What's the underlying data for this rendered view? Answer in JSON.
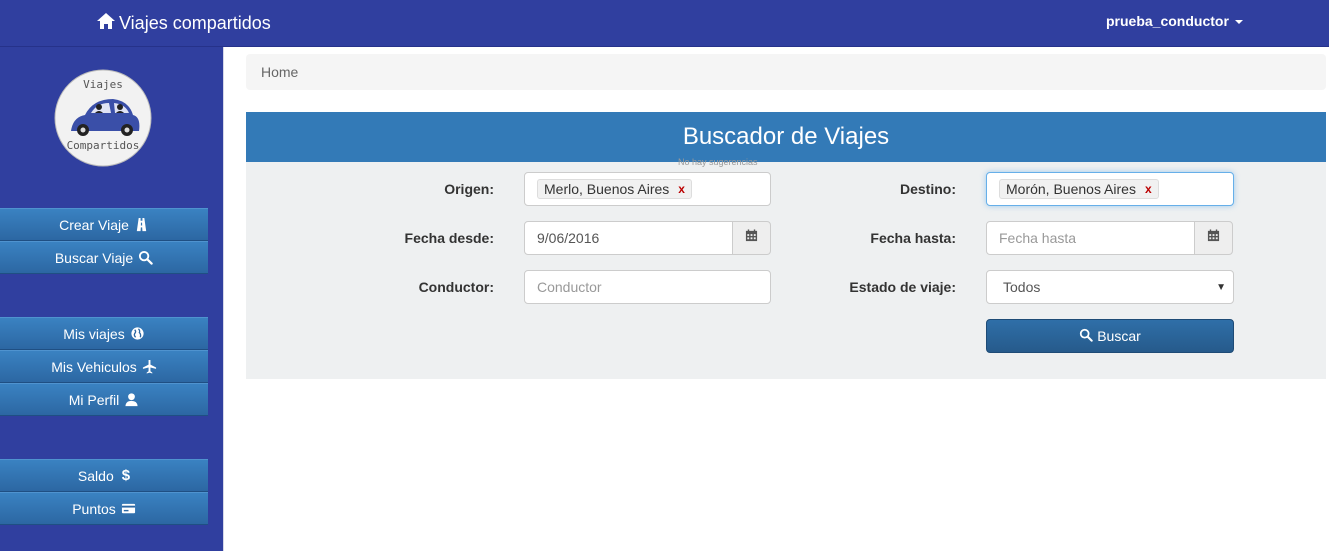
{
  "navbar": {
    "brand": "Viajes compartidos",
    "brand_icon": "home-icon",
    "user": "prueba_conductor"
  },
  "logo": {
    "top_text": "Viajes",
    "bottom_text": "Compartidos"
  },
  "sidebar": {
    "items": [
      {
        "label": "Crear Viaje",
        "icon": "road-icon"
      },
      {
        "label": "Buscar Viaje",
        "icon": "search-icon"
      },
      {
        "label": "Mis viajes",
        "icon": "globe-icon"
      },
      {
        "label": "Mis Vehiculos",
        "icon": "plane-icon"
      },
      {
        "label": "Mi Perfil",
        "icon": "user-icon"
      },
      {
        "label": "Saldo",
        "icon": "dollar-icon"
      },
      {
        "label": "Puntos",
        "icon": "credit-card-icon"
      }
    ]
  },
  "breadcrumb": "Home",
  "panel": {
    "title": "Buscador de Viajes",
    "hint": "No hay sugerencias",
    "origen_label": "Origen:",
    "origen_tag": "Merlo, Buenos Aires",
    "destino_label": "Destino:",
    "destino_tag": "Morón, Buenos Aires",
    "tag_remove": "x",
    "fecha_desde_label": "Fecha desde:",
    "fecha_desde_value": "9/06/2016",
    "fecha_hasta_label": "Fecha hasta:",
    "fecha_hasta_placeholder": "Fecha hasta",
    "conductor_label": "Conductor:",
    "conductor_placeholder": "Conductor",
    "estado_label": "Estado de viaje:",
    "estado_value": "Todos",
    "buscar_label": "Buscar"
  },
  "colors": {
    "navbar": "#303f9f",
    "panel_header": "#337ab7",
    "button": "#2c67a3"
  }
}
